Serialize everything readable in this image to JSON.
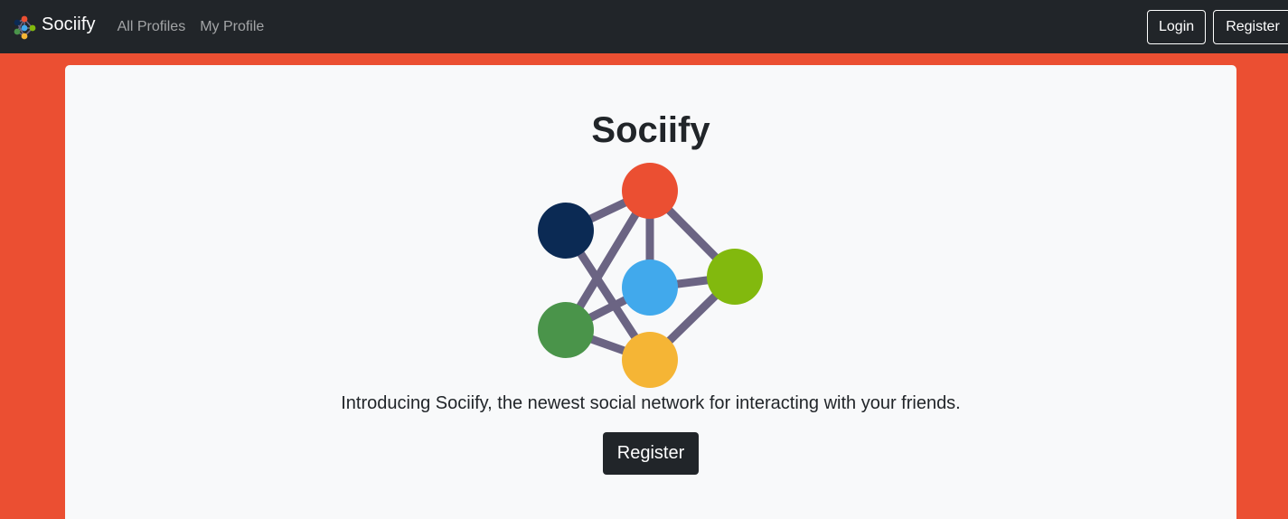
{
  "navbar": {
    "brand": "Sociify",
    "links": [
      "All Profiles",
      "My Profile"
    ],
    "login_label": "Login",
    "register_label": "Register"
  },
  "hero": {
    "title": "Sociify",
    "tagline": "Introducing Sociify, the newest social network for interacting with your friends.",
    "cta_label": "Register"
  },
  "colors": {
    "page_background": "#eb4f32",
    "navbar": "#212529",
    "card": "#f8f9fa",
    "edge": "#6b6483",
    "node_red": "#eb4f32",
    "node_navy": "#0b2a54",
    "node_blue": "#41a9ec",
    "node_lime": "#82b90e",
    "node_green": "#4a944a",
    "node_yellow": "#f5b535"
  }
}
